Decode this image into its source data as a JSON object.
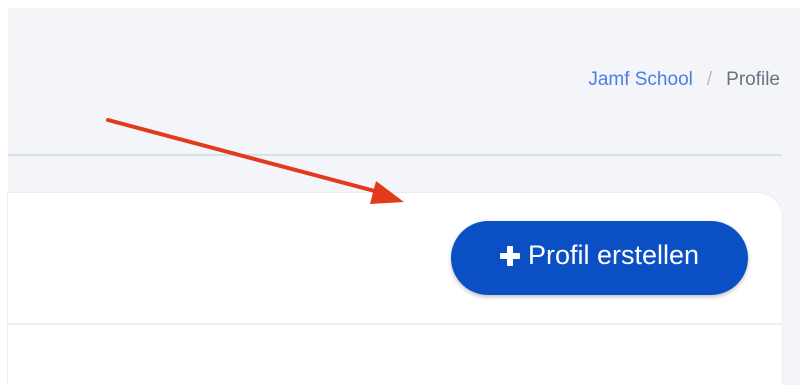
{
  "breadcrumb": {
    "root": "Jamf School",
    "separator": "/",
    "current": "Profile"
  },
  "toolbar": {
    "create_label": "Profil erstellen",
    "create_icon": "plus-icon"
  },
  "colors": {
    "background": "#f4f5f9",
    "link": "#4a7ee6",
    "primary_button": "#0b4fc4",
    "annotation_arrow": "#e23b1c"
  }
}
